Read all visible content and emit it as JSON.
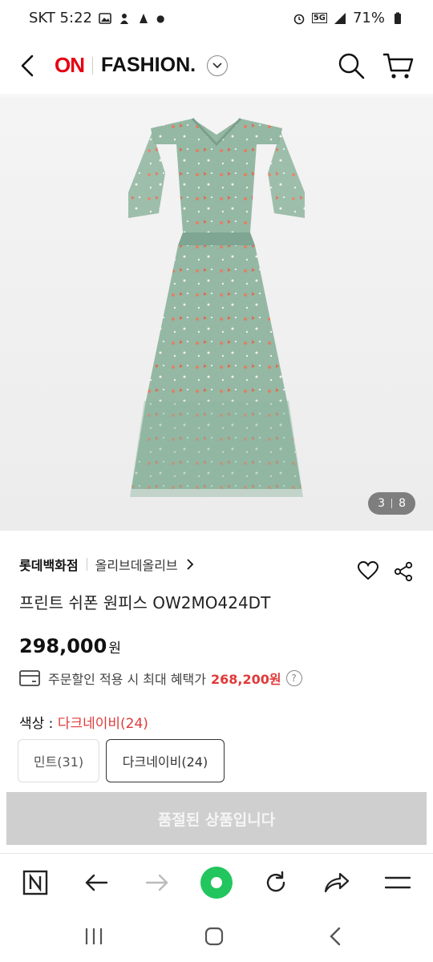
{
  "status": {
    "carrier_time": "SKT 5:22",
    "battery": "71%",
    "network": "5G"
  },
  "header": {
    "logo_on": "ON",
    "logo_fashion": "FASHION."
  },
  "gallery": {
    "current": "3",
    "total": "8"
  },
  "product": {
    "store": "롯데백화점",
    "brand": "올리브데올리브",
    "name": "프린트 쉬폰 원피스 OW2MO424DT",
    "price": "298,000",
    "price_unit": "원",
    "benefit_text": "주문할인 적용 시 최대 혜택가",
    "benefit_amount": "268,200원",
    "color_label": "색상 : ",
    "color_selected": "다크네이비(24)",
    "options": [
      "민트(31)",
      "다크네이비(24)"
    ],
    "soldout_label": "품절된 상품입니다"
  },
  "colors": {
    "accent_red": "#e60012",
    "price_red": "#e03a3a",
    "dress_green": "#8fb5a0",
    "soldout_gray": "#cfcfcf",
    "browser_green": "#22c55e"
  }
}
